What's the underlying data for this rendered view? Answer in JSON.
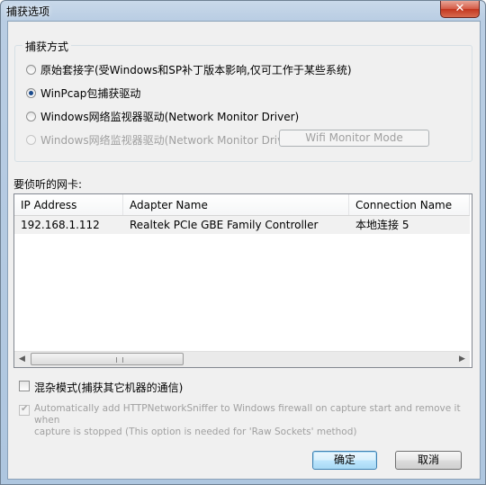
{
  "window": {
    "title": "捕获选项",
    "close_label": "✕"
  },
  "capture_group": {
    "legend": "捕获方式",
    "options": [
      {
        "label": "原始套接字(受Windows和SP补丁版本影响,仅可工作于某些系统)",
        "checked": false,
        "disabled": false
      },
      {
        "label": "WinPcap包捕获驱动",
        "checked": true,
        "disabled": false
      },
      {
        "label": "Windows网络监视器驱动(Network Monitor Driver)",
        "checked": false,
        "disabled": false
      },
      {
        "label": "Windows网络监视器驱动(Network Monitor Driver) 3",
        "checked": false,
        "disabled": true
      }
    ],
    "wifi_button": "Wifi Monitor Mode"
  },
  "adapters": {
    "label": "要侦听的网卡:",
    "columns": [
      "IP Address",
      "Adapter Name",
      "Connection Name"
    ],
    "rows": [
      {
        "ip": "192.168.1.112",
        "adapter": "Realtek PCIe GBE Family Controller",
        "connection": "本地连接 5"
      }
    ]
  },
  "options": {
    "promiscuous_label": "混杂模式(捕获其它机器的通信)",
    "firewall_label_line1": "Automatically add HTTPNetworkSniffer to Windows firewall on capture start and remove it when",
    "firewall_label_line2": "capture is stopped (This option is needed for 'Raw Sockets' method)"
  },
  "buttons": {
    "ok": "确定",
    "cancel": "取消"
  }
}
